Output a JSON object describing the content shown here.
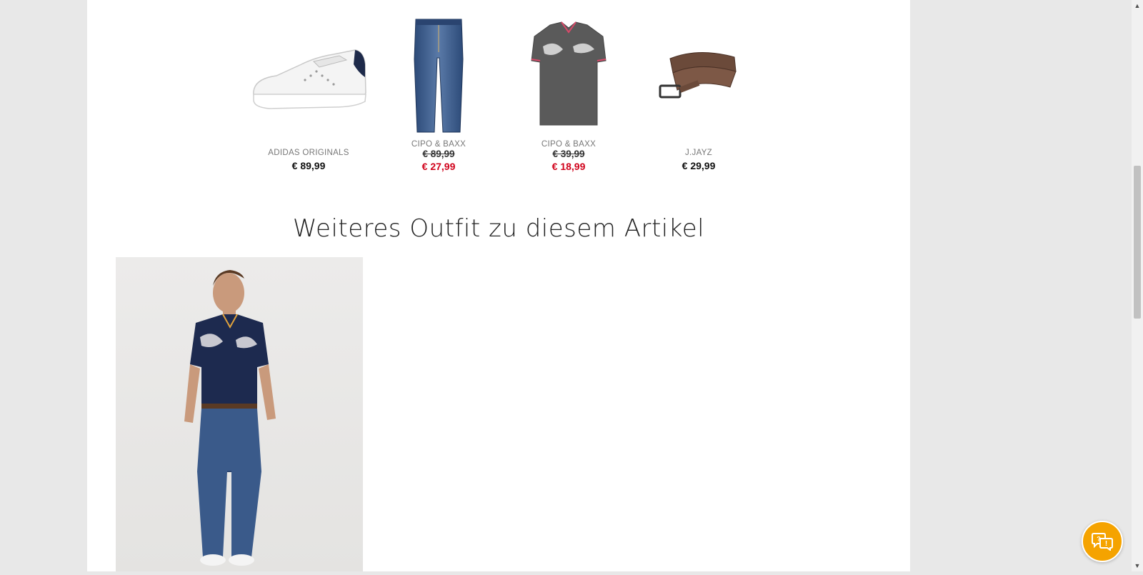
{
  "products": [
    {
      "brand": "ADIDAS ORIGINALS",
      "price": "€ 89,99",
      "image": "white-sneaker"
    },
    {
      "brand": "CIPO & BAXX",
      "price_old": "€ 89,99",
      "price_sale": "€ 27,99",
      "image": "blue-jeans"
    },
    {
      "brand": "CIPO & BAXX",
      "price_old": "€ 39,99",
      "price_sale": "€ 18,99",
      "image": "grey-polo-shirt"
    },
    {
      "brand": "J.JAYZ",
      "price": "€ 29,99",
      "image": "brown-belt"
    }
  ],
  "section": {
    "title": "Weiteres Outfit zu diesem Artikel"
  },
  "outfit": {
    "image": "model-navy-polo-jeans"
  },
  "chat": {
    "icon": "chat-bubbles-icon"
  },
  "colors": {
    "sale": "#d0021b",
    "chat_button": "#f5a300",
    "background": "#e8e8e8"
  }
}
